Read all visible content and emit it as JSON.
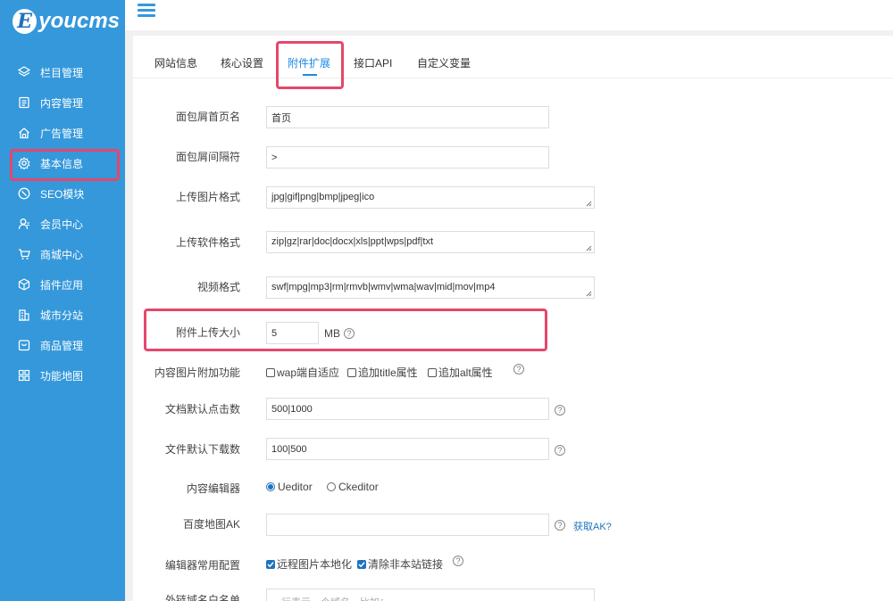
{
  "brand": {
    "logo_letter": "E",
    "logo_text": "youcms"
  },
  "sidebar": {
    "items": [
      {
        "label": "栏目管理",
        "icon": "layers-icon"
      },
      {
        "label": "内容管理",
        "icon": "document-icon"
      },
      {
        "label": "广告管理",
        "icon": "home-icon"
      },
      {
        "label": "基本信息",
        "icon": "gear-icon",
        "highlighted": true
      },
      {
        "label": "SEO模块",
        "icon": "seo-icon"
      },
      {
        "label": "会员中心",
        "icon": "user-icon"
      },
      {
        "label": "商城中心",
        "icon": "cart-icon"
      },
      {
        "label": "插件应用",
        "icon": "cube-icon"
      },
      {
        "label": "城市分站",
        "icon": "building-icon"
      },
      {
        "label": "商品管理",
        "icon": "package-icon"
      },
      {
        "label": "功能地图",
        "icon": "grid-icon"
      }
    ]
  },
  "tabs": [
    "网站信息",
    "核心设置",
    "附件扩展",
    "接口API",
    "自定义变量"
  ],
  "active_tab": "附件扩展",
  "form": {
    "crumb_home": {
      "label": "面包屑首页名",
      "value": "首页"
    },
    "crumb_sep": {
      "label": "面包屑间隔符",
      "value": ">"
    },
    "image_types": {
      "label": "上传图片格式",
      "value": "jpg|gif|png|bmp|jpeg|ico"
    },
    "soft_types": {
      "label": "上传软件格式",
      "value": "zip|gz|rar|doc|docx|xls|ppt|wps|pdf|txt"
    },
    "video_types": {
      "label": "视频格式",
      "value": "swf|mpg|mp3|rm|rmvb|wmv|wma|wav|mid|mov|mp4"
    },
    "upload_size": {
      "label": "附件上传大小",
      "value": "5",
      "unit": "MB"
    },
    "content_img": {
      "label": "内容图片附加功能",
      "options": [
        {
          "label": "wap端自适应",
          "checked": false
        },
        {
          "label": "追加title属性",
          "checked": false
        },
        {
          "label": "追加alt属性",
          "checked": false
        }
      ]
    },
    "doc_clicks": {
      "label": "文档默认点击数",
      "value": "500|1000"
    },
    "file_downloads": {
      "label": "文件默认下载数",
      "value": "100|500"
    },
    "editor": {
      "label": "内容编辑器",
      "options": [
        {
          "label": "Ueditor",
          "selected": true
        },
        {
          "label": "Ckeditor",
          "selected": false
        }
      ]
    },
    "baidu_ak": {
      "label": "百度地图AK",
      "value": "",
      "link": "获取AK?"
    },
    "editor_config": {
      "label": "编辑器常用配置",
      "options": [
        {
          "label": "远程图片本地化",
          "checked": true
        },
        {
          "label": "清除非本站链接",
          "checked": true
        }
      ]
    },
    "domain_whitelist": {
      "label": "外链域名白名单",
      "placeholder": "一行表示一个域名，比如："
    }
  },
  "help_glyph": "?",
  "colors": {
    "sidebar": "#3498db",
    "accent": "#1e88e5",
    "highlight": "#e5476b"
  }
}
